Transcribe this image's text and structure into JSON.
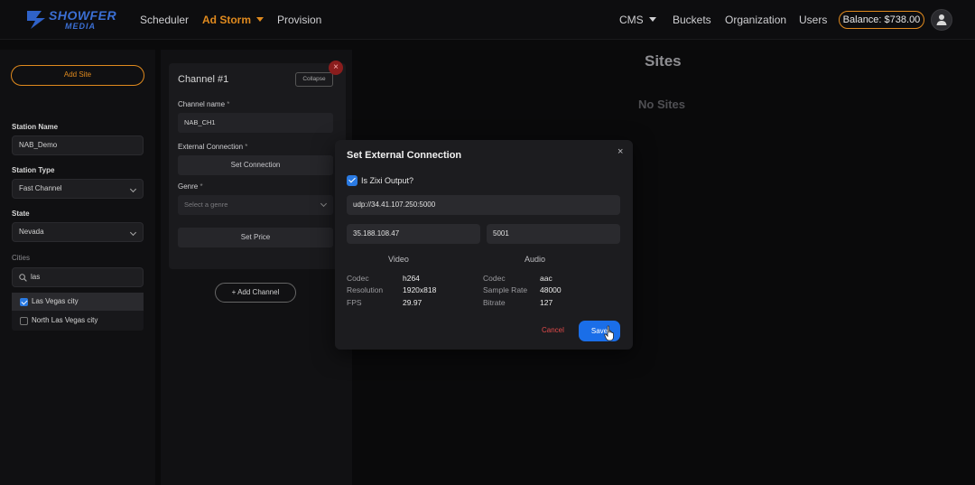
{
  "nav": {
    "logo_main": "SHOWFER",
    "logo_sub": "MEDIA",
    "scheduler": "Scheduler",
    "ad_storm": "Ad Storm",
    "provision": "Provision",
    "cms": "CMS",
    "buckets": "Buckets",
    "organization": "Organization",
    "users": "Users",
    "balance": "Balance: $738.00",
    "accent": "#e08a1e"
  },
  "left": {
    "add_site": "Add Site",
    "station_name_label": "Station Name",
    "station_name_value": "NAB_Demo",
    "station_type_label": "Station Type",
    "station_type_value": "Fast Channel",
    "state_label": "State",
    "state_value": "Nevada",
    "cities_label": "Cities",
    "cities_search": "las",
    "cities": [
      {
        "name": "Las Vegas city",
        "checked": true
      },
      {
        "name": "North Las Vegas city",
        "checked": false
      }
    ]
  },
  "channel": {
    "title": "Channel #1",
    "collapse": "Collapse",
    "name_label": "Channel name",
    "name_value": "NAB_CH1",
    "ext_label": "External Connection",
    "set_connection": "Set Connection",
    "genre_label": "Genre",
    "genre_placeholder": "Select a genre",
    "set_price": "Set Price",
    "add_channel": "Add Channel",
    "required_mark": "*",
    "close_glyph": "×"
  },
  "sites": {
    "title": "Sites",
    "empty": "No Sites"
  },
  "modal": {
    "title": "Set External Connection",
    "close_glyph": "×",
    "zixi_label": "Is Zixi Output?",
    "zixi_checked": true,
    "url": "udp://34.41.107.250:5000",
    "ip": "35.188.108.47",
    "port": "5001",
    "video_head": "Video",
    "audio_head": "Audio",
    "video": [
      {
        "k": "Codec",
        "v": "h264"
      },
      {
        "k": "Resolution",
        "v": "1920x818"
      },
      {
        "k": "FPS",
        "v": "29.97"
      }
    ],
    "audio": [
      {
        "k": "Codec",
        "v": "aac"
      },
      {
        "k": "Sample Rate",
        "v": "48000"
      },
      {
        "k": "Bitrate",
        "v": "127"
      }
    ],
    "cancel": "Cancel",
    "save": "Save"
  }
}
